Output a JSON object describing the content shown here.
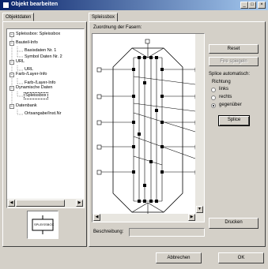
{
  "window": {
    "title": "Objekt bearbeiten",
    "min_glyph": "_",
    "max_glyph": "□",
    "close_glyph": "×"
  },
  "left_tab": {
    "label": "Objektdaten"
  },
  "tree": {
    "items": [
      {
        "label": "Spleissbox: Spleissbox",
        "expander": "−"
      },
      {
        "label": "Bauteil-Info",
        "expander": "−"
      },
      {
        "label": "Basisdaten Nr. 1"
      },
      {
        "label": "Symbol Daten Nr. 2"
      },
      {
        "label": "URL",
        "expander": "−"
      },
      {
        "label": "URL"
      },
      {
        "label": "Farb-/Layer-Info",
        "expander": "−"
      },
      {
        "label": "Farb-/Layer-Info"
      },
      {
        "label": "Dynamische Daten",
        "expander": "−"
      },
      {
        "label": "Spleissbox"
      },
      {
        "label": "Datenbank",
        "expander": "−"
      },
      {
        "label": "Ortsangabe/Inst.Nr"
      }
    ]
  },
  "preview": {
    "label": "SPLEISSBOX"
  },
  "right_tab": {
    "label": "Spleissbox"
  },
  "diagram": {
    "heading": "Zuordnung der Fasern:"
  },
  "buttons": {
    "reset": "Reset",
    "mirror": "Fire spiegeln",
    "splice": "Splice",
    "print": "Drucken",
    "cancel": "Abbrechen",
    "ok": "OK"
  },
  "splice_auto": {
    "label": "Splice automatisch:",
    "direction_label": "Richtung",
    "options": [
      "links",
      "rechts",
      "gegenüber"
    ],
    "selected": "gegenüber"
  },
  "description": {
    "label": "Beschreibung:",
    "value": ""
  }
}
